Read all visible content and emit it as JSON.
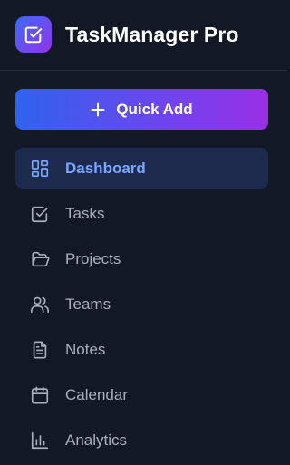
{
  "brand": {
    "title": "TaskManager Pro",
    "logo_icon": "check-square-icon",
    "gradient": [
      "#3b6cf6",
      "#9333ea"
    ]
  },
  "quick_add": {
    "label": "Quick Add",
    "icon": "plus-icon",
    "gradient": [
      "#2f63ef",
      "#9a2fe8"
    ]
  },
  "nav": {
    "active": "Dashboard",
    "active_color": "#79a7ff",
    "items": [
      {
        "label": "Dashboard",
        "icon": "dashboard-grid-icon"
      },
      {
        "label": "Tasks",
        "icon": "checkbox-icon"
      },
      {
        "label": "Projects",
        "icon": "folder-icon"
      },
      {
        "label": "Teams",
        "icon": "users-icon"
      },
      {
        "label": "Notes",
        "icon": "document-icon"
      },
      {
        "label": "Calendar",
        "icon": "calendar-icon"
      },
      {
        "label": "Analytics",
        "icon": "bar-chart-icon"
      }
    ]
  }
}
